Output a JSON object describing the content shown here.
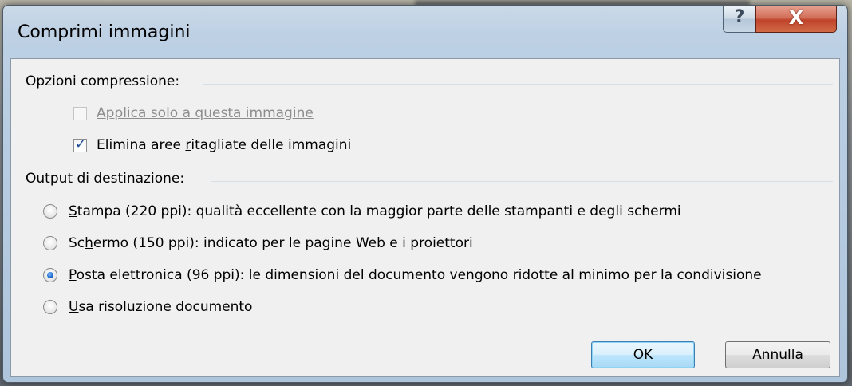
{
  "window": {
    "title": "Comprimi immagini",
    "help_glyph": "?",
    "close_glyph": "X"
  },
  "compression": {
    "group_label": "Opzioni compressione:",
    "apply_only_this": {
      "label": "Applica solo a questa immagine",
      "checked": false,
      "enabled": false
    },
    "delete_cropped": {
      "label_before": "Elimina aree ",
      "label_access": "r",
      "label_after": "itagliate delle immagini",
      "checked": true,
      "enabled": true
    }
  },
  "output": {
    "group_label": "Output di destinazione:",
    "options": [
      {
        "access": "S",
        "rest": "tampa (220 ppi): qualità eccellente con la maggior parte delle stampanti e degli schermi",
        "selected": false
      },
      {
        "prefix": "Sc",
        "access": "h",
        "rest": "ermo (150 ppi): indicato per le pagine Web e i proiettori",
        "selected": false
      },
      {
        "access": "P",
        "rest": "osta elettronica (96 ppi): le dimensioni del documento vengono ridotte al minimo per la condivisione",
        "selected": true
      },
      {
        "access": "U",
        "rest": "sa risoluzione documento",
        "selected": false
      }
    ]
  },
  "buttons": {
    "ok": "OK",
    "cancel": "Annulla"
  },
  "colors": {
    "accent_blue": "#1c66c9",
    "close_red": "#c0432a",
    "dialog_face": "#f0f0f0"
  }
}
